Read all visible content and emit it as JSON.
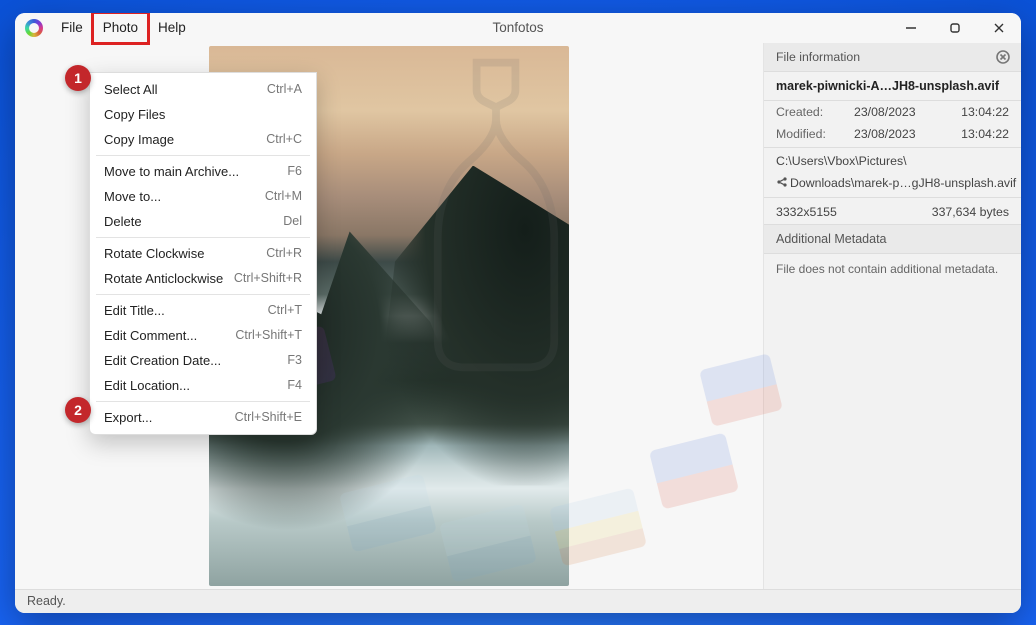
{
  "app": {
    "title": "Tonfotos"
  },
  "menubar": {
    "file": "File",
    "photo": "Photo",
    "help": "Help"
  },
  "dropdown": {
    "items": [
      {
        "label": "Select All",
        "shortcut": "Ctrl+A"
      },
      {
        "label": "Copy Files",
        "shortcut": ""
      },
      {
        "label": "Copy Image",
        "shortcut": "Ctrl+C"
      },
      "---",
      {
        "label": "Move to main Archive...",
        "shortcut": "F6"
      },
      {
        "label": "Move to...",
        "shortcut": "Ctrl+M"
      },
      {
        "label": "Delete",
        "shortcut": "Del"
      },
      "---",
      {
        "label": "Rotate Clockwise",
        "shortcut": "Ctrl+R"
      },
      {
        "label": "Rotate Anticlockwise",
        "shortcut": "Ctrl+Shift+R"
      },
      "---",
      {
        "label": "Edit Title...",
        "shortcut": "Ctrl+T"
      },
      {
        "label": "Edit Comment...",
        "shortcut": "Ctrl+Shift+T"
      },
      {
        "label": "Edit Creation Date...",
        "shortcut": "F3"
      },
      {
        "label": "Edit Location...",
        "shortcut": "F4"
      },
      "---",
      {
        "label": "Export...",
        "shortcut": "Ctrl+Shift+E"
      }
    ]
  },
  "info": {
    "header": "File information",
    "filename": "marek-piwnicki-A…JH8-unsplash.avif",
    "created_label": "Created:",
    "created_date": "23/08/2023",
    "created_time": "13:04:22",
    "modified_label": "Modified:",
    "modified_date": "23/08/2023",
    "modified_time": "13:04:22",
    "path1": "C:\\Users\\Vbox\\Pictures\\",
    "path2": "Downloads\\marek-p…gJH8-unsplash.avif",
    "dimensions": "3332x5155",
    "bytes": "337,634 bytes",
    "meta_header": "Additional Metadata",
    "meta_note": "File does not contain additional metadata."
  },
  "status": {
    "text": "Ready."
  },
  "callouts": {
    "one": "1",
    "two": "2"
  }
}
